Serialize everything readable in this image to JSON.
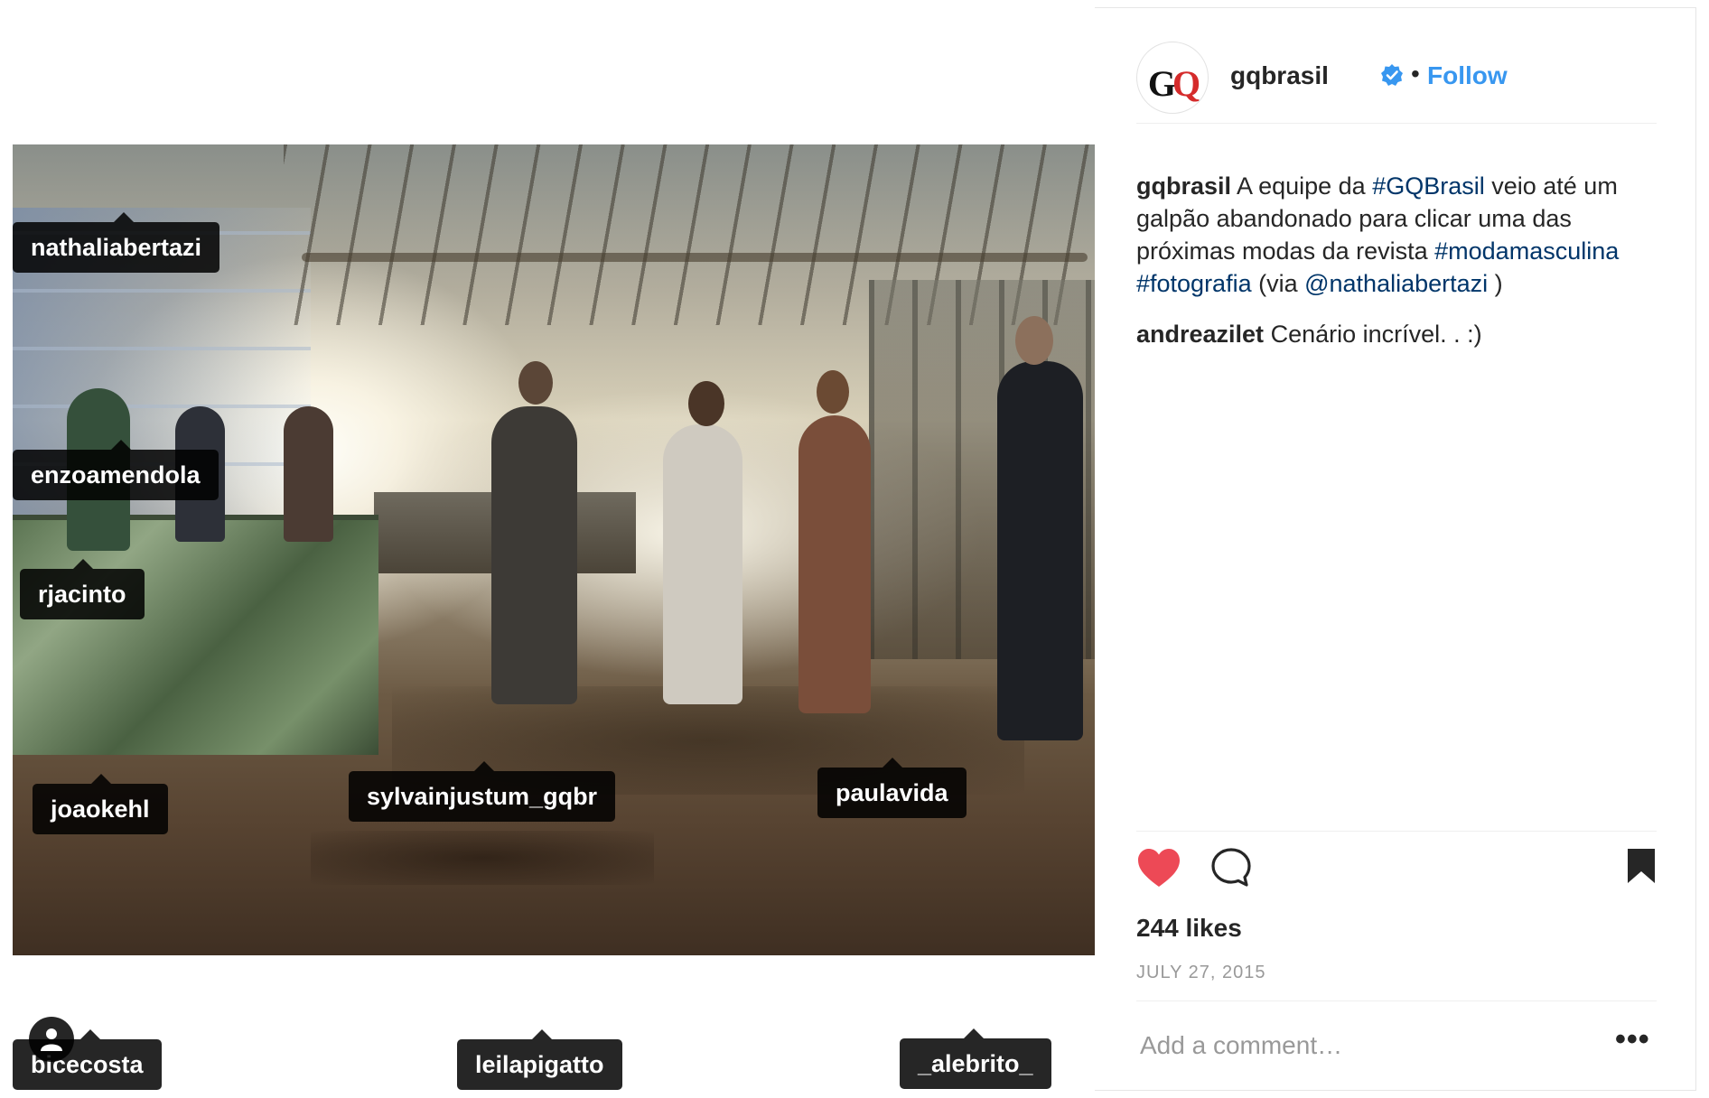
{
  "post": {
    "username": "gqbrasil",
    "follow_label": "Follow",
    "separator": "•",
    "avatar_logo_g": "G",
    "avatar_logo_q": "Q",
    "caption": {
      "username": "gqbrasil",
      "part1": " A equipe da ",
      "tag1": "#GQBrasil",
      "part2": " veio até um galpão abandonado para clicar uma das próximas modas da revista ",
      "tag2": "#modamasculina",
      "part3": " ",
      "tag3": "#fotografia",
      "part4": " (via ",
      "mention": "@nathaliabertazi",
      "part5": " )"
    },
    "comments": [
      {
        "username": "andreazilet",
        "text": " Cenário incrível. . :)"
      }
    ],
    "likes": "244 likes",
    "date": "JULY 27, 2015",
    "comment_placeholder": "Add a comment…",
    "more_label": "•••"
  },
  "tags": [
    {
      "name": "nathaliabertazi"
    },
    {
      "name": "enzoamendola"
    },
    {
      "name": "rjacinto"
    },
    {
      "name": "joaokehl"
    },
    {
      "name": "sylvainjustum_gqbr"
    },
    {
      "name": "paulavida"
    },
    {
      "name": "bicecosta"
    },
    {
      "name": "leilapigatto"
    },
    {
      "name": "_alebrito_"
    }
  ],
  "icons": {
    "verified": "verified-badge-icon",
    "heart": "heart-icon",
    "comment": "comment-bubble-icon",
    "bookmark": "bookmark-icon",
    "user_tags": "user-silhouette-icon"
  },
  "colors": {
    "link": "#003569",
    "follow": "#3897f0",
    "heart": "#ed4956",
    "verified": "#3897f0"
  }
}
